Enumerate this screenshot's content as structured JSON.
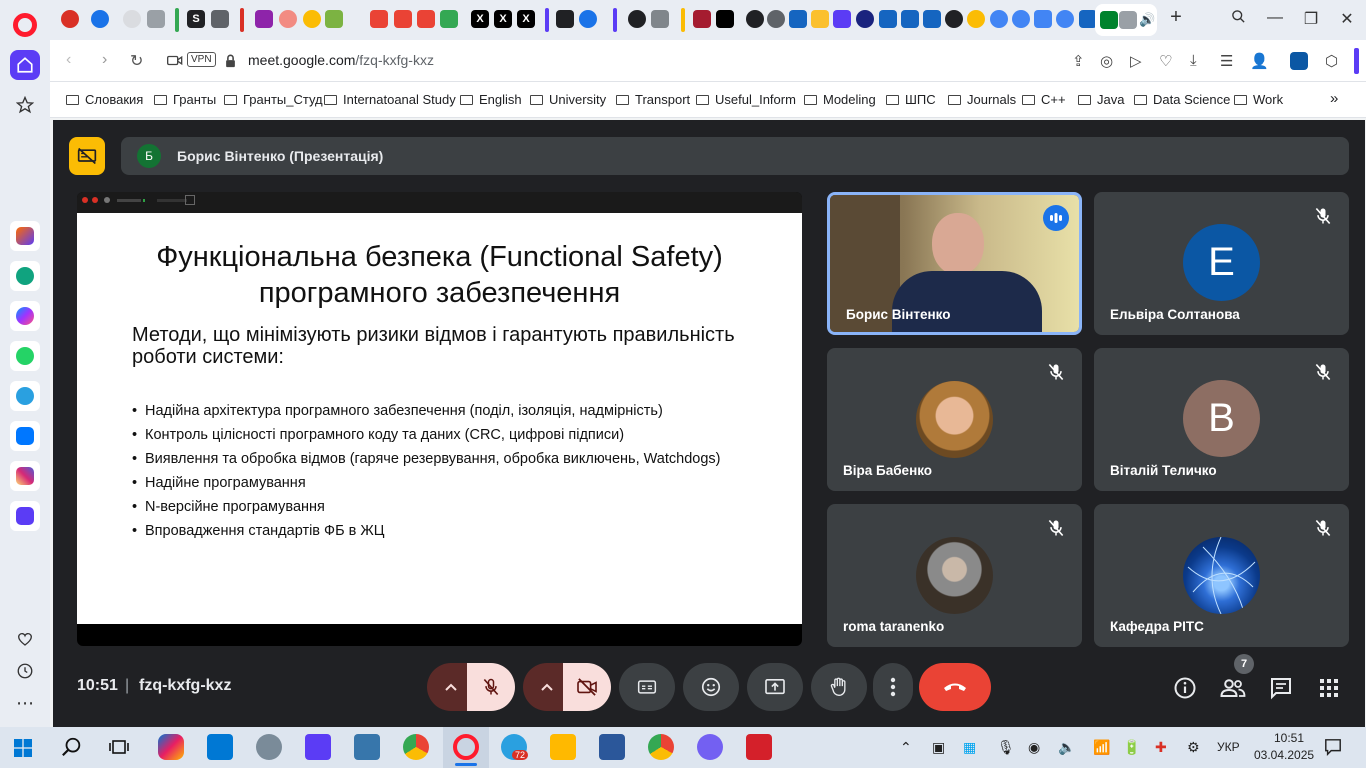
{
  "browser": {
    "tabs_note_labels": [
      "S",
      "X",
      "X",
      "X"
    ],
    "address": {
      "vpn_label": "VPN",
      "host": "meet.google.com",
      "path": "/fzq-kxfg-kxz"
    },
    "bookmarks": [
      {
        "label": "Словакия"
      },
      {
        "label": "Гранты"
      },
      {
        "label": "Гранты_Студ"
      },
      {
        "label": "Internatoanal Study"
      },
      {
        "label": "English"
      },
      {
        "label": "University"
      },
      {
        "label": "Transport"
      },
      {
        "label": "Useful_Inform"
      },
      {
        "label": "Modeling"
      },
      {
        "label": "ШПС"
      },
      {
        "label": "Journals"
      },
      {
        "label": "C++"
      },
      {
        "label": "Java"
      },
      {
        "label": "Data Scienсe"
      },
      {
        "label": "Work"
      }
    ],
    "bookmarks_more": "»"
  },
  "meet": {
    "presenter": {
      "avatar_letter": "Б",
      "name": "Борис Вінтенко (Презентація)"
    },
    "slide": {
      "title_line1": "Функціональна безпека (Functional Safety)",
      "title_line2": "програмного забезпечення",
      "subtitle": "Методи, що мінімізують ризики відмов і гарантують правильність роботи системи:",
      "bullets": [
        "Надійна архітектура програмного забезпечення (поділ, ізоляція, надмірність)",
        "Контроль цілісності програмного коду та даних (CRC, цифрові підписи)",
        "Виявлення та обробка відмов (гаряче резервування, обробка виключень, Watchdogs)",
        "Надійне програмування",
        "N-версійне програмування",
        "Впровадження стандартів ФБ в ЖЦ"
      ]
    },
    "participants": [
      {
        "name": "Борис Вінтенко",
        "type": "video",
        "speaking": true
      },
      {
        "name": "Ельвіра Солтанова",
        "type": "letter",
        "letter": "E",
        "color": "#0b57a4",
        "muted": true
      },
      {
        "name": "Віра Бабенко",
        "type": "photo",
        "muted": true
      },
      {
        "name": "Віталій Теличко",
        "type": "letter",
        "letter": "B",
        "color": "#8d6e63",
        "muted": true
      },
      {
        "name": "roma taranenko",
        "type": "photo",
        "muted": true
      },
      {
        "name": "Кафедра РІТС",
        "type": "photo",
        "muted": true
      }
    ],
    "time": "10:51",
    "separator": "|",
    "meeting_code": "fzq-kxfg-kxz",
    "people_count": "7",
    "colors": {
      "background": "#202124",
      "tile": "#3c4043",
      "leave": "#ea4335",
      "active_border": "#8ab4f8"
    }
  },
  "taskbar": {
    "badge_count": "72",
    "language": "УКР",
    "time": "10:51",
    "date": "03.04.2025"
  }
}
